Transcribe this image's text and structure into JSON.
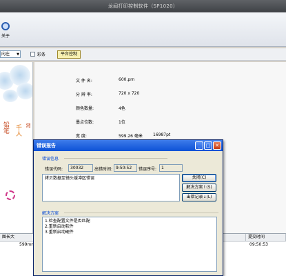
{
  "app": {
    "title": "龙闻打印控制软件（SP1020）"
  },
  "toolbar": {
    "tool_label": "关于"
  },
  "options": {
    "direction_value": "向左",
    "color_label": "彩条",
    "platform_label": "平台控制"
  },
  "preview": {
    "text_a": "铅笔",
    "text_b": "千人",
    "text_c": "湘"
  },
  "info": {
    "rows": [
      {
        "key": "文 件 名:",
        "value": "600.prn",
        "value2": ""
      },
      {
        "key": "分 辨 率:",
        "value": "720 x 720",
        "value2": ""
      },
      {
        "key": "颜色数量:",
        "value": "4色",
        "value2": ""
      },
      {
        "key": "墨点位数:",
        "value": "1位",
        "value2": ""
      },
      {
        "key": "宽    度:",
        "value": "599.26 毫米",
        "value2": "16987pt"
      }
    ]
  },
  "status": {
    "col1_header": "图长大",
    "col1_value": "599mm",
    "col2_header": "提交时间",
    "col2_value": "09:50:53"
  },
  "dialog": {
    "title": "错误报告",
    "error_group": "错误信息",
    "code_label": "错误代码:",
    "code_value": "30032",
    "time_label": "出错时间:",
    "time_value": "9:50:52",
    "seq_label": "错误序号:",
    "seq_value": "1",
    "message": "拷贝数据至镜头缓冲区错误",
    "solution_group": "解决方案",
    "solutions": [
      "1.检查配置文件是否匹配",
      "2.重新启动软件",
      "3.重新启动硬件"
    ],
    "btn_close": "关闭(C)",
    "btn_solution": "解决方案↑(S)",
    "btn_log": "出错记录↓(L)"
  }
}
